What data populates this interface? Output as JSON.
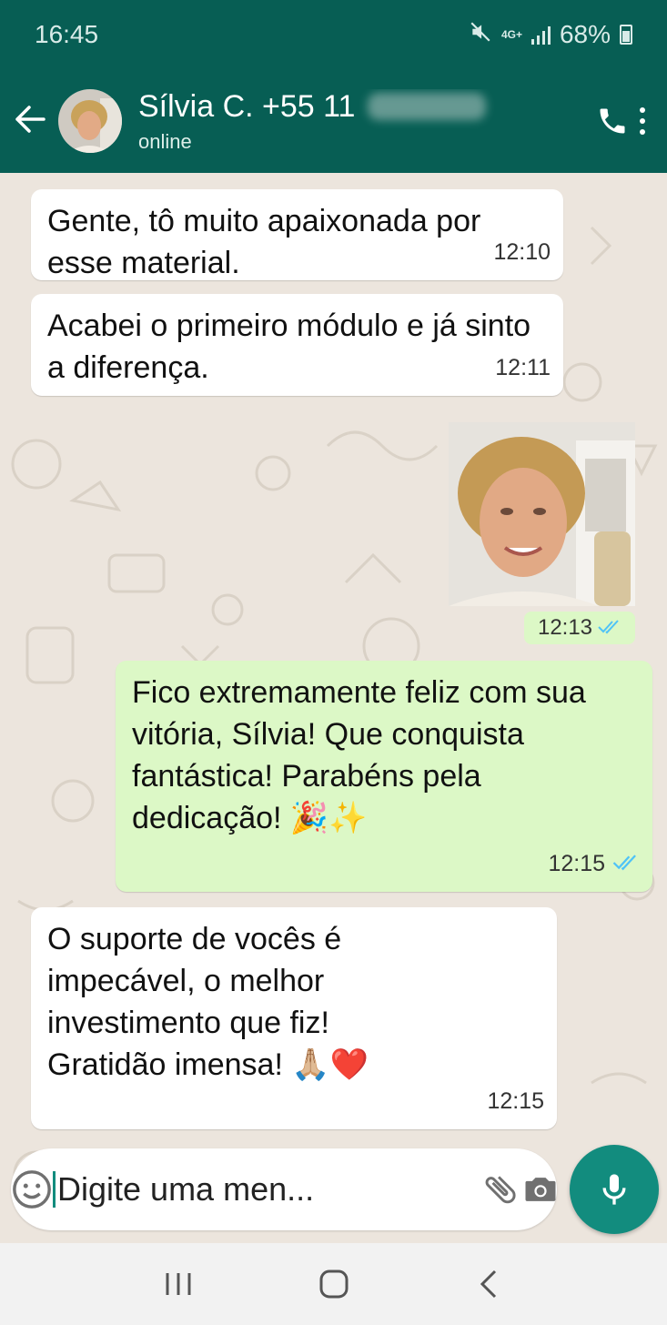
{
  "status_bar": {
    "time": "16:45",
    "network": "4G+",
    "battery": "68%"
  },
  "header": {
    "contact_name": "Sílvia C. +55 11",
    "contact_status": "online"
  },
  "messages": [
    {
      "direction": "incoming",
      "text": "Gente, tô muito apaixonada por esse material.",
      "time": "12:10"
    },
    {
      "direction": "incoming",
      "text": "Acabei o primeiro módulo e já sinto a diferença.",
      "time": "12:11"
    },
    {
      "direction": "outgoing",
      "type": "photo",
      "time": "12:13",
      "status": "read"
    },
    {
      "direction": "outgoing",
      "text": "Fico extremamente feliz com sua vitória, Sílvia! Que conquista fantástica! Parabéns pela dedicação! 🎉✨",
      "time": "12:15",
      "status": "read"
    },
    {
      "direction": "incoming",
      "text": "O suporte de vocês é impecável, o melhor investimento que fiz! Gratidão imensa! 🙏🏼❤️",
      "time": "12:15"
    }
  ],
  "input": {
    "placeholder": "Digite uma men..."
  },
  "colors": {
    "header": "#075e54",
    "accent": "#128c7e",
    "outgoing_bubble": "#dcf8c6",
    "incoming_bubble": "#ffffff",
    "read_ticks": "#4fc3f7",
    "chat_background": "#ece5dd"
  },
  "icons": {
    "back": "arrow-left-icon",
    "call": "phone-icon",
    "menu": "more-vert-icon",
    "emoji": "smiley-icon",
    "attach": "paperclip-icon",
    "camera": "camera-icon",
    "mic": "microphone-icon",
    "nav_recents": "recents-icon",
    "nav_home": "home-icon",
    "nav_back": "nav-back-icon"
  }
}
